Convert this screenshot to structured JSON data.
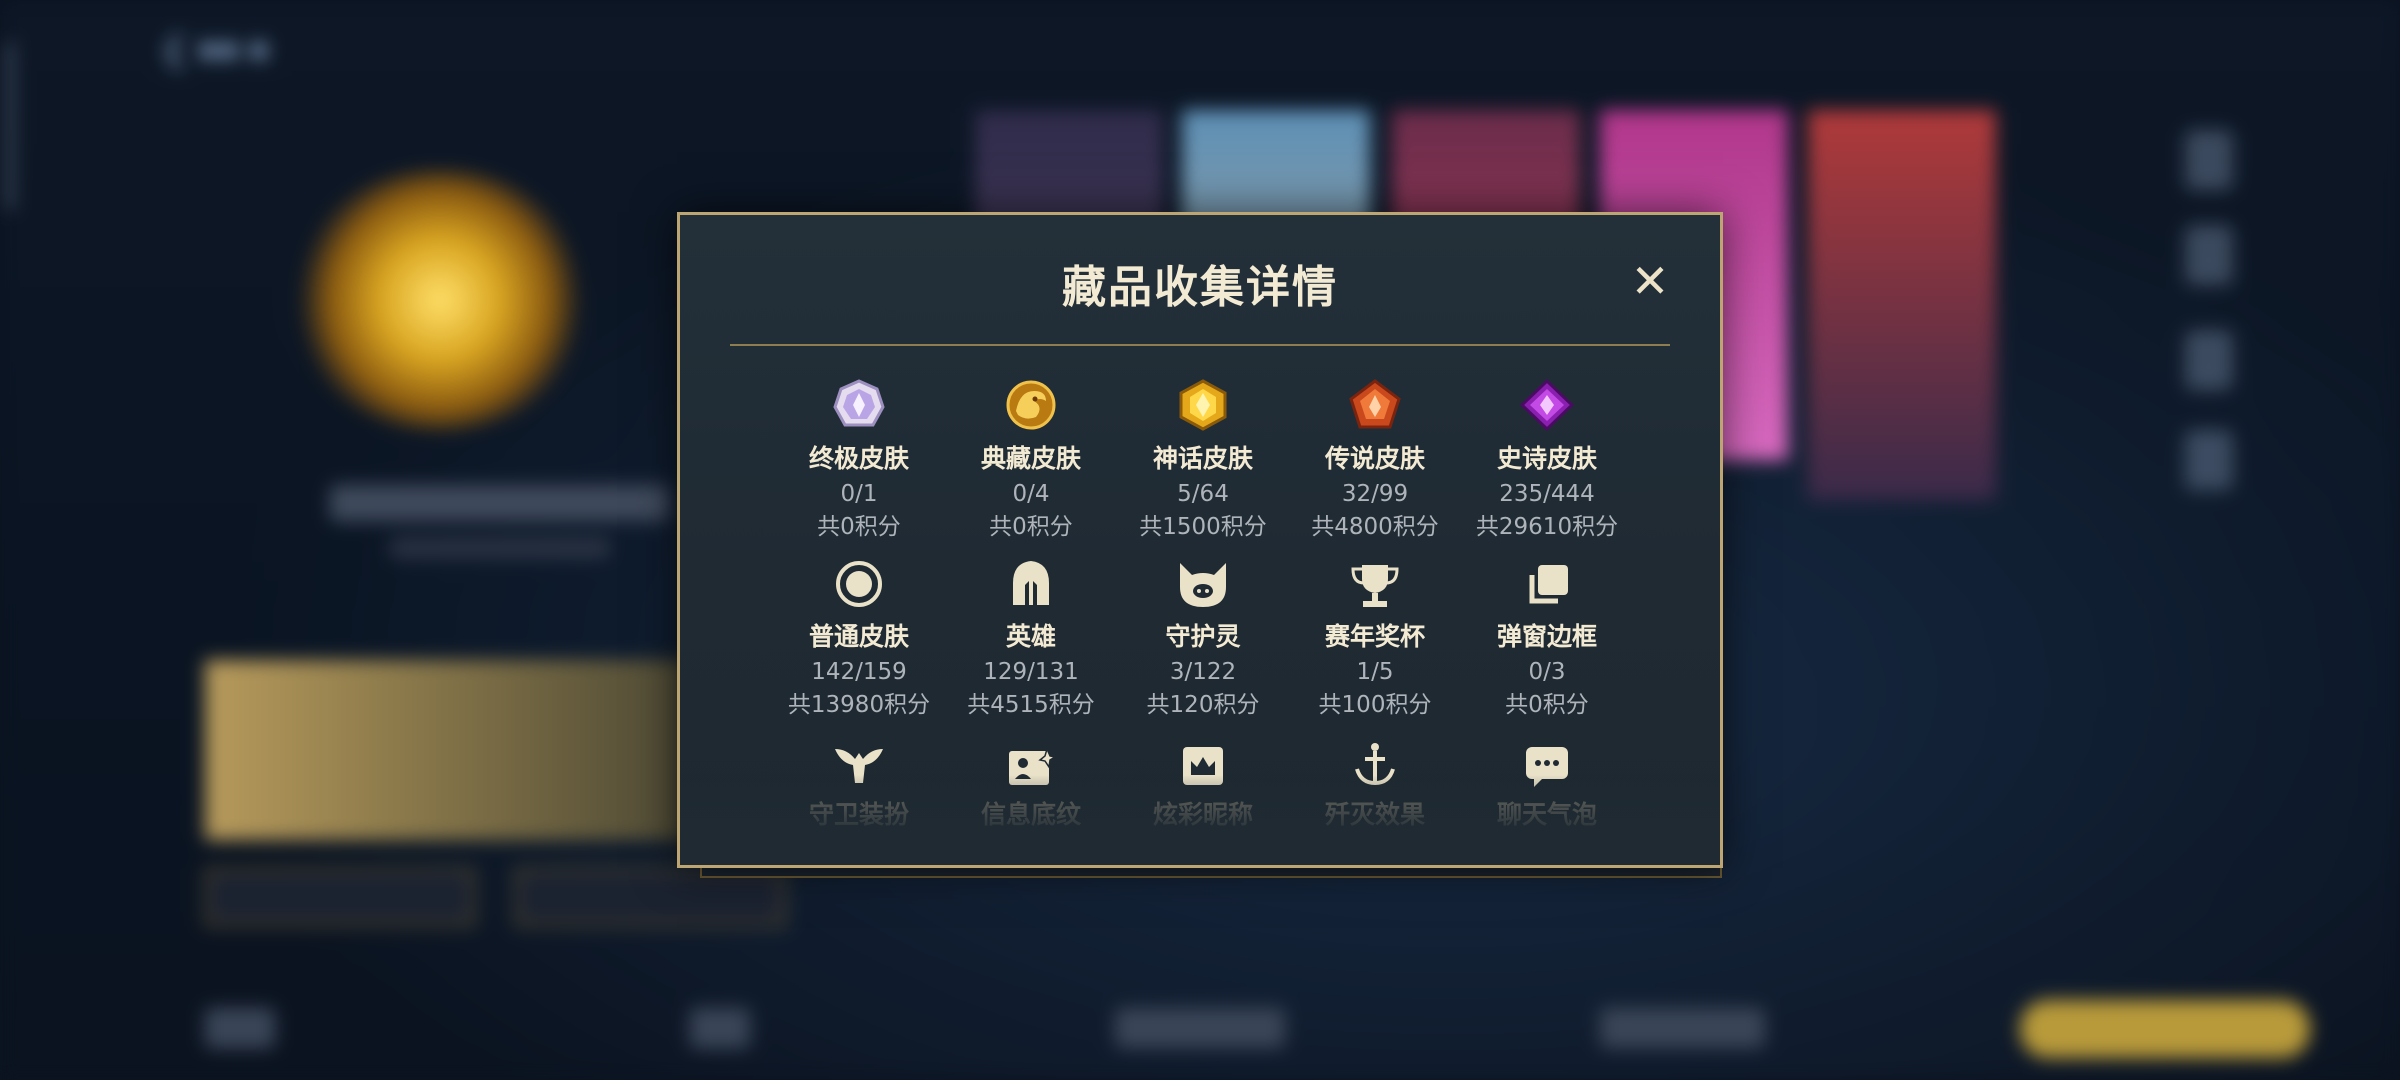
{
  "modal": {
    "title": "藏品收集详情",
    "close_symbol": "✕"
  },
  "categories": [
    {
      "label": "终极皮肤",
      "count": "0/1",
      "points": "共0积分",
      "icon": "ultimate-skin-gem-icon"
    },
    {
      "label": "典藏皮肤",
      "count": "0/4",
      "points": "共0积分",
      "icon": "collector-skin-dragon-icon"
    },
    {
      "label": "神话皮肤",
      "count": "5/64",
      "points": "共1500积分",
      "icon": "mythic-skin-gem-icon"
    },
    {
      "label": "传说皮肤",
      "count": "32/99",
      "points": "共4800积分",
      "icon": "legendary-skin-gem-icon"
    },
    {
      "label": "史诗皮肤",
      "count": "235/444",
      "points": "共29610积分",
      "icon": "epic-skin-gem-icon"
    },
    {
      "label": "普通皮肤",
      "count": "142/159",
      "points": "共13980积分",
      "icon": "common-skin-circle-icon"
    },
    {
      "label": "英雄",
      "count": "129/131",
      "points": "共4515积分",
      "icon": "hero-helmet-icon"
    },
    {
      "label": "守护灵",
      "count": "3/122",
      "points": "共120积分",
      "icon": "guardian-spirit-icon"
    },
    {
      "label": "赛年奖杯",
      "count": "1/5",
      "points": "共100积分",
      "icon": "season-trophy-icon"
    },
    {
      "label": "弹窗边框",
      "count": "0/3",
      "points": "共0积分",
      "icon": "popup-frame-icon"
    },
    {
      "label": "守卫装扮",
      "icon": "ward-skin-icon"
    },
    {
      "label": "信息底纹",
      "icon": "info-card-icon"
    },
    {
      "label": "炫彩昵称",
      "icon": "colorful-nickname-icon"
    },
    {
      "label": "歼灭效果",
      "icon": "elimination-effect-icon"
    },
    {
      "label": "聊天气泡",
      "icon": "chat-bubble-icon"
    }
  ],
  "colors": {
    "gold_border": "#bda671",
    "title_text": "#f3ead3",
    "secondary_text": "#aeb4ba",
    "modal_bg": "#1f2a33"
  }
}
